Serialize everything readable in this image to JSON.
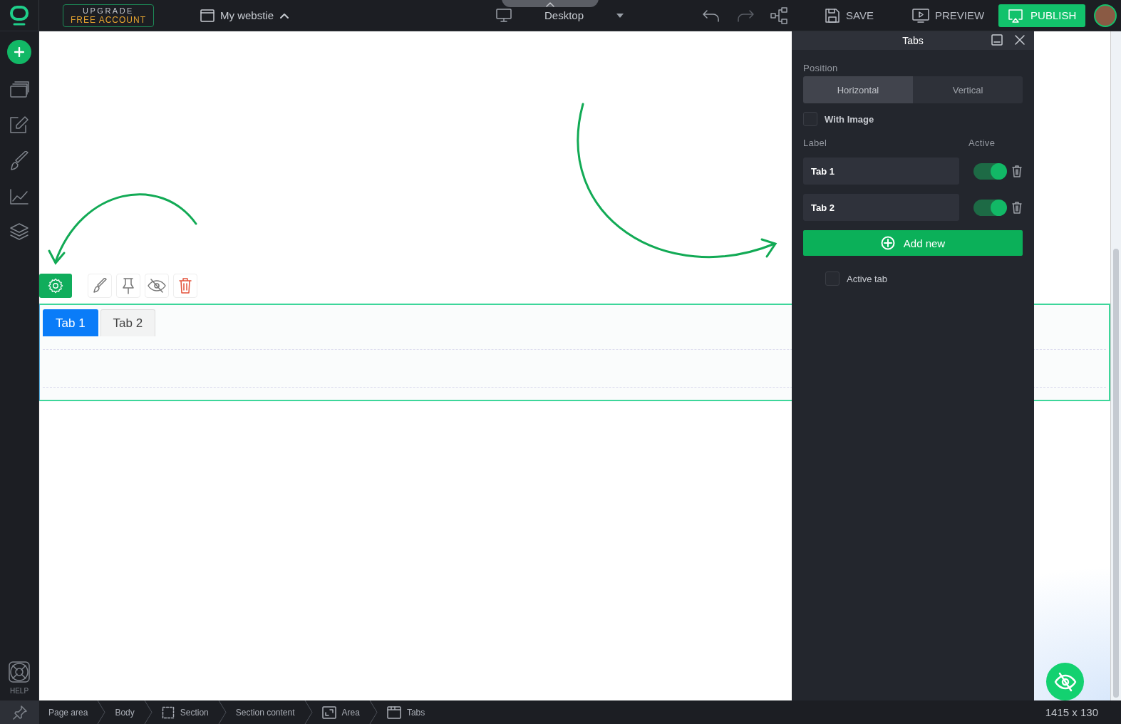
{
  "topbar": {
    "upgrade_top": "UPGRADE",
    "upgrade_bottom": "FREE ACCOUNT",
    "site_name": "My webstie",
    "device": "Desktop",
    "save": "SAVE",
    "preview": "PREVIEW",
    "publish": "PUBLISH"
  },
  "sidebar": {
    "help": "HELP"
  },
  "canvas": {
    "tabs": [
      {
        "label": "Tab 1",
        "selected": true
      },
      {
        "label": "Tab 2",
        "selected": false
      }
    ]
  },
  "panel": {
    "title": "Tabs",
    "position_label": "Position",
    "position_options": [
      {
        "label": "Horizontal",
        "selected": true
      },
      {
        "label": "Vertical",
        "selected": false
      }
    ],
    "with_image": {
      "label": "With Image",
      "checked": false
    },
    "label_header": "Label",
    "active_header": "Active",
    "tab_rows": [
      {
        "value": "Tab 1",
        "on": true
      },
      {
        "value": "Tab 2",
        "on": true
      }
    ],
    "add_button": "Add new",
    "active_tab": {
      "label": "Active tab",
      "checked": false
    }
  },
  "breadcrumbs": [
    {
      "label": "Page area",
      "kind": "plain"
    },
    {
      "label": "Body",
      "kind": "plain"
    },
    {
      "label": "Section",
      "kind": "section"
    },
    {
      "label": "Section content",
      "kind": "plain"
    },
    {
      "label": "Area",
      "kind": "area"
    },
    {
      "label": "Tabs",
      "kind": "tabs"
    }
  ],
  "dimensions": "1415 x 130"
}
